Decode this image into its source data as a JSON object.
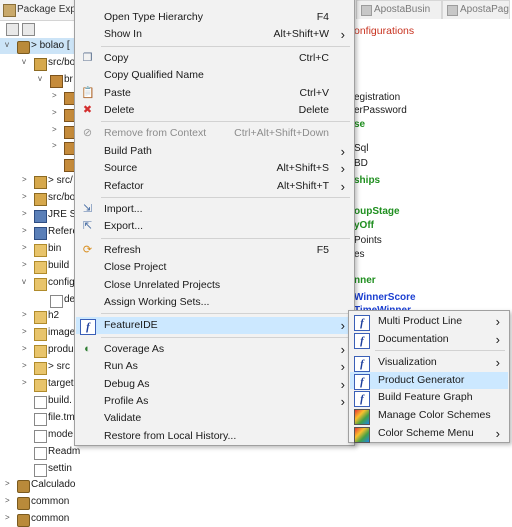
{
  "explorer": {
    "tab_label": "Package Explo",
    "tree": [
      {
        "label": "> bolao [",
        "icon": "project-icon",
        "twisty": "v"
      },
      {
        "label": "src/bo",
        "icon": "source-folder-icon",
        "twisty": "v"
      },
      {
        "label": "br",
        "icon": "package-icon",
        "twisty": "v"
      },
      {
        "label": "",
        "icon": "package-icon",
        "twisty": ">"
      },
      {
        "label": "",
        "icon": "package-icon",
        "twisty": ">"
      },
      {
        "label": "",
        "icon": "package-icon",
        "twisty": ">"
      },
      {
        "label": "",
        "icon": "package-icon",
        "twisty": ">"
      },
      {
        "label": "",
        "icon": "package-icon",
        "twisty": ""
      },
      {
        "label": "> src/",
        "icon": "source-folder-icon",
        "twisty": ">"
      },
      {
        "label": "src/bo",
        "icon": "source-folder-icon",
        "twisty": ">"
      },
      {
        "label": "JRE Sy",
        "icon": "library-icon",
        "twisty": ">"
      },
      {
        "label": "Refere",
        "icon": "library-icon",
        "twisty": ">"
      },
      {
        "label": "bin",
        "icon": "folder-icon",
        "twisty": ">"
      },
      {
        "label": "build",
        "icon": "folder-icon",
        "twisty": ">"
      },
      {
        "label": "config",
        "icon": "folder-icon",
        "twisty": "v"
      },
      {
        "label": "de",
        "icon": "file-icon",
        "twisty": ""
      },
      {
        "label": "h2",
        "icon": "folder-icon",
        "twisty": ">"
      },
      {
        "label": "image",
        "icon": "folder-icon",
        "twisty": ">"
      },
      {
        "label": "produ",
        "icon": "folder-icon",
        "twisty": ">"
      },
      {
        "label": "> src",
        "icon": "folder-icon",
        "twisty": ">"
      },
      {
        "label": "target",
        "icon": "folder-icon",
        "twisty": ">"
      },
      {
        "label": "build.",
        "icon": "file-icon",
        "twisty": ""
      },
      {
        "label": "file.tm",
        "icon": "file-icon",
        "twisty": ""
      },
      {
        "label": "mode",
        "icon": "file-icon",
        "twisty": ""
      },
      {
        "label": "Readm",
        "icon": "file-icon",
        "twisty": ""
      },
      {
        "label": "settin",
        "icon": "file-icon",
        "twisty": ""
      },
      {
        "label": "Calculado",
        "icon": "project-icon",
        "twisty": ">"
      },
      {
        "label": "common",
        "icon": "project-icon",
        "twisty": ">"
      },
      {
        "label": "common",
        "icon": "project-icon",
        "twisty": ">"
      }
    ]
  },
  "editor": {
    "tabs": [
      {
        "label": "ApostaBusin"
      },
      {
        "label": "ApostaPag"
      }
    ],
    "heading": "onfigurations",
    "lines": [
      {
        "text": "egistration",
        "style": "black"
      },
      {
        "text": "erPassword",
        "style": "black"
      },
      {
        "text": "se",
        "style": "green"
      },
      {
        "text": "Sql",
        "style": "black"
      },
      {
        "text": "BD",
        "style": "black"
      },
      {
        "text": "ships",
        "style": "green"
      },
      {
        "text": "oupStage",
        "style": "green"
      },
      {
        "text": "yOff",
        "style": "green"
      },
      {
        "text": "Points",
        "style": "black"
      },
      {
        "text": "es",
        "style": "black"
      },
      {
        "text": "nner",
        "style": "green"
      },
      {
        "text": "WinnerScore",
        "style": "blue"
      },
      {
        "text": "TimeWinner",
        "style": "blue"
      }
    ]
  },
  "context_menu": {
    "items": [
      {
        "label": "Open Type Hierarchy",
        "accel": "F4",
        "icon": "",
        "submenu": false,
        "disabled": false
      },
      {
        "label": "Show In",
        "accel": "Alt+Shift+W",
        "icon": "",
        "submenu": true,
        "disabled": false
      },
      {
        "sep": true
      },
      {
        "label": "Copy",
        "accel": "Ctrl+C",
        "icon": "copy-icon",
        "submenu": false,
        "disabled": false
      },
      {
        "label": "Copy Qualified Name",
        "accel": "",
        "icon": "",
        "submenu": false,
        "disabled": false
      },
      {
        "label": "Paste",
        "accel": "Ctrl+V",
        "icon": "paste-icon",
        "submenu": false,
        "disabled": false
      },
      {
        "label": "Delete",
        "accel": "Delete",
        "icon": "delete-icon",
        "submenu": false,
        "disabled": false
      },
      {
        "sep": true
      },
      {
        "label": "Remove from Context",
        "accel": "Ctrl+Alt+Shift+Down",
        "icon": "remove-context-icon",
        "submenu": false,
        "disabled": true
      },
      {
        "label": "Build Path",
        "accel": "",
        "icon": "",
        "submenu": true,
        "disabled": false
      },
      {
        "label": "Source",
        "accel": "Alt+Shift+S",
        "icon": "",
        "submenu": true,
        "disabled": false
      },
      {
        "label": "Refactor",
        "accel": "Alt+Shift+T",
        "icon": "",
        "submenu": true,
        "disabled": false
      },
      {
        "sep": true
      },
      {
        "label": "Import...",
        "accel": "",
        "icon": "import-icon",
        "submenu": false,
        "disabled": false
      },
      {
        "label": "Export...",
        "accel": "",
        "icon": "export-icon",
        "submenu": false,
        "disabled": false
      },
      {
        "sep": true
      },
      {
        "label": "Refresh",
        "accel": "F5",
        "icon": "refresh-icon",
        "submenu": false,
        "disabled": false
      },
      {
        "label": "Close Project",
        "accel": "",
        "icon": "",
        "submenu": false,
        "disabled": false
      },
      {
        "label": "Close Unrelated Projects",
        "accel": "",
        "icon": "",
        "submenu": false,
        "disabled": false
      },
      {
        "label": "Assign Working Sets...",
        "accel": "",
        "icon": "",
        "submenu": false,
        "disabled": false
      },
      {
        "sep": true
      },
      {
        "label": "FeatureIDE",
        "accel": "",
        "icon": "featureide-icon",
        "submenu": true,
        "disabled": false,
        "active": true
      },
      {
        "sep": true
      },
      {
        "label": "Coverage As",
        "accel": "",
        "icon": "coverage-icon",
        "submenu": true,
        "disabled": false
      },
      {
        "label": "Run As",
        "accel": "",
        "icon": "",
        "submenu": true,
        "disabled": false
      },
      {
        "label": "Debug As",
        "accel": "",
        "icon": "",
        "submenu": true,
        "disabled": false
      },
      {
        "label": "Profile As",
        "accel": "",
        "icon": "",
        "submenu": true,
        "disabled": false
      },
      {
        "label": "Validate",
        "accel": "",
        "icon": "",
        "submenu": false,
        "disabled": false
      },
      {
        "label": "Restore from Local History...",
        "accel": "",
        "icon": "",
        "submenu": false,
        "disabled": false
      }
    ]
  },
  "featureide_submenu": {
    "items": [
      {
        "label": "Multi Product Line",
        "icon": "featureide-icon",
        "submenu": true
      },
      {
        "label": "Documentation",
        "icon": "featureide-icon",
        "submenu": true
      },
      {
        "sep": true
      },
      {
        "label": "Visualization",
        "icon": "featureide-icon",
        "submenu": true
      },
      {
        "label": "Product Generator",
        "icon": "featureide-icon",
        "submenu": false,
        "active": true
      },
      {
        "label": "Build Feature Graph",
        "icon": "featureide-icon",
        "submenu": false
      },
      {
        "label": "Manage Color Schemes",
        "icon": "color-scheme-icon",
        "submenu": false
      },
      {
        "label": "Color Scheme Menu",
        "icon": "color-scheme-icon",
        "submenu": true
      }
    ]
  },
  "colors": {
    "menu_bg": "#f2f2f2",
    "highlight": "#cce8ff",
    "selection": "#cce4f7",
    "editor_red": "#c8321f",
    "editor_green": "#1f8f1f",
    "editor_blue": "#1b3fd1"
  }
}
